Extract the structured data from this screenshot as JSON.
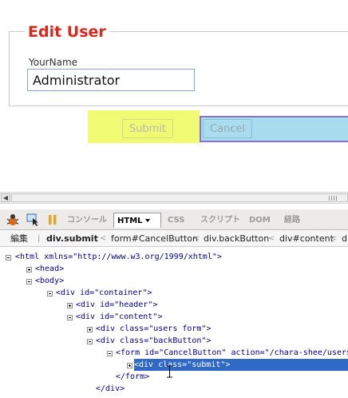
{
  "form": {
    "legend": "Edit User",
    "name_label": "YourName",
    "name_value": "Administrator",
    "submit_label": "Submit",
    "cancel_label": "Cancel"
  },
  "firebug": {
    "tabs": [
      {
        "label": "コンソール"
      },
      {
        "label": "HTML"
      },
      {
        "label": "CSS"
      },
      {
        "label": "スクリプト"
      },
      {
        "label": "DOM"
      },
      {
        "label": "経路"
      }
    ],
    "edit_label": "編集",
    "breadcrumbs": [
      "div.submit",
      "form#CancelButton",
      "div.backButton",
      "div#content",
      "d"
    ],
    "tree": [
      {
        "text": "<html xmlns=\"http://www.w3.org/1999/xhtml\">"
      },
      {
        "text": "<head>"
      },
      {
        "text": "<body>"
      },
      {
        "text": "<div id=\"container\">"
      },
      {
        "text": "<div id=\"header\">"
      },
      {
        "text": "<div id=\"content\">"
      },
      {
        "text": "<div class=\"users form\">"
      },
      {
        "text": "<div class=\"backButton\">"
      },
      {
        "text": "<form id=\"CancelButton\" action=\"/chara-shee/users"
      },
      {
        "text": "<div class=\"submit\">"
      },
      {
        "text": "</form>"
      },
      {
        "text": "</div>"
      }
    ]
  }
}
